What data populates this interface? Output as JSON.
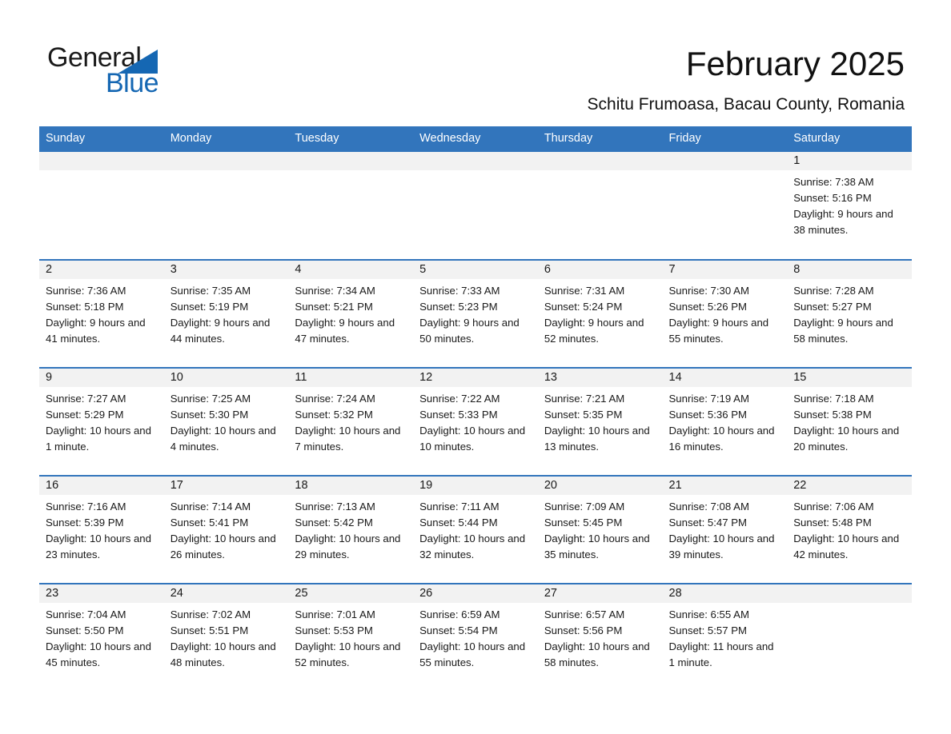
{
  "brand": {
    "name_part1": "General",
    "name_part2": "Blue",
    "logo_icon": "general-blue-triangle-logo",
    "blue": "#1567b3"
  },
  "header": {
    "title": "February 2025",
    "subtitle": "Schitu Frumoasa, Bacau County, Romania",
    "accent_color": "#3275bc",
    "band_color": "#f2f2f2"
  },
  "weekday_headers": [
    "Sunday",
    "Monday",
    "Tuesday",
    "Wednesday",
    "Thursday",
    "Friday",
    "Saturday"
  ],
  "weeks": [
    [
      {
        "day": "",
        "sunrise": "",
        "sunset": "",
        "daylight": ""
      },
      {
        "day": "",
        "sunrise": "",
        "sunset": "",
        "daylight": ""
      },
      {
        "day": "",
        "sunrise": "",
        "sunset": "",
        "daylight": ""
      },
      {
        "day": "",
        "sunrise": "",
        "sunset": "",
        "daylight": ""
      },
      {
        "day": "",
        "sunrise": "",
        "sunset": "",
        "daylight": ""
      },
      {
        "day": "",
        "sunrise": "",
        "sunset": "",
        "daylight": ""
      },
      {
        "day": "1",
        "sunrise": "Sunrise: 7:38 AM",
        "sunset": "Sunset: 5:16 PM",
        "daylight": "Daylight: 9 hours and 38 minutes."
      }
    ],
    [
      {
        "day": "2",
        "sunrise": "Sunrise: 7:36 AM",
        "sunset": "Sunset: 5:18 PM",
        "daylight": "Daylight: 9 hours and 41 minutes."
      },
      {
        "day": "3",
        "sunrise": "Sunrise: 7:35 AM",
        "sunset": "Sunset: 5:19 PM",
        "daylight": "Daylight: 9 hours and 44 minutes."
      },
      {
        "day": "4",
        "sunrise": "Sunrise: 7:34 AM",
        "sunset": "Sunset: 5:21 PM",
        "daylight": "Daylight: 9 hours and 47 minutes."
      },
      {
        "day": "5",
        "sunrise": "Sunrise: 7:33 AM",
        "sunset": "Sunset: 5:23 PM",
        "daylight": "Daylight: 9 hours and 50 minutes."
      },
      {
        "day": "6",
        "sunrise": "Sunrise: 7:31 AM",
        "sunset": "Sunset: 5:24 PM",
        "daylight": "Daylight: 9 hours and 52 minutes."
      },
      {
        "day": "7",
        "sunrise": "Sunrise: 7:30 AM",
        "sunset": "Sunset: 5:26 PM",
        "daylight": "Daylight: 9 hours and 55 minutes."
      },
      {
        "day": "8",
        "sunrise": "Sunrise: 7:28 AM",
        "sunset": "Sunset: 5:27 PM",
        "daylight": "Daylight: 9 hours and 58 minutes."
      }
    ],
    [
      {
        "day": "9",
        "sunrise": "Sunrise: 7:27 AM",
        "sunset": "Sunset: 5:29 PM",
        "daylight": "Daylight: 10 hours and 1 minute."
      },
      {
        "day": "10",
        "sunrise": "Sunrise: 7:25 AM",
        "sunset": "Sunset: 5:30 PM",
        "daylight": "Daylight: 10 hours and 4 minutes."
      },
      {
        "day": "11",
        "sunrise": "Sunrise: 7:24 AM",
        "sunset": "Sunset: 5:32 PM",
        "daylight": "Daylight: 10 hours and 7 minutes."
      },
      {
        "day": "12",
        "sunrise": "Sunrise: 7:22 AM",
        "sunset": "Sunset: 5:33 PM",
        "daylight": "Daylight: 10 hours and 10 minutes."
      },
      {
        "day": "13",
        "sunrise": "Sunrise: 7:21 AM",
        "sunset": "Sunset: 5:35 PM",
        "daylight": "Daylight: 10 hours and 13 minutes."
      },
      {
        "day": "14",
        "sunrise": "Sunrise: 7:19 AM",
        "sunset": "Sunset: 5:36 PM",
        "daylight": "Daylight: 10 hours and 16 minutes."
      },
      {
        "day": "15",
        "sunrise": "Sunrise: 7:18 AM",
        "sunset": "Sunset: 5:38 PM",
        "daylight": "Daylight: 10 hours and 20 minutes."
      }
    ],
    [
      {
        "day": "16",
        "sunrise": "Sunrise: 7:16 AM",
        "sunset": "Sunset: 5:39 PM",
        "daylight": "Daylight: 10 hours and 23 minutes."
      },
      {
        "day": "17",
        "sunrise": "Sunrise: 7:14 AM",
        "sunset": "Sunset: 5:41 PM",
        "daylight": "Daylight: 10 hours and 26 minutes."
      },
      {
        "day": "18",
        "sunrise": "Sunrise: 7:13 AM",
        "sunset": "Sunset: 5:42 PM",
        "daylight": "Daylight: 10 hours and 29 minutes."
      },
      {
        "day": "19",
        "sunrise": "Sunrise: 7:11 AM",
        "sunset": "Sunset: 5:44 PM",
        "daylight": "Daylight: 10 hours and 32 minutes."
      },
      {
        "day": "20",
        "sunrise": "Sunrise: 7:09 AM",
        "sunset": "Sunset: 5:45 PM",
        "daylight": "Daylight: 10 hours and 35 minutes."
      },
      {
        "day": "21",
        "sunrise": "Sunrise: 7:08 AM",
        "sunset": "Sunset: 5:47 PM",
        "daylight": "Daylight: 10 hours and 39 minutes."
      },
      {
        "day": "22",
        "sunrise": "Sunrise: 7:06 AM",
        "sunset": "Sunset: 5:48 PM",
        "daylight": "Daylight: 10 hours and 42 minutes."
      }
    ],
    [
      {
        "day": "23",
        "sunrise": "Sunrise: 7:04 AM",
        "sunset": "Sunset: 5:50 PM",
        "daylight": "Daylight: 10 hours and 45 minutes."
      },
      {
        "day": "24",
        "sunrise": "Sunrise: 7:02 AM",
        "sunset": "Sunset: 5:51 PM",
        "daylight": "Daylight: 10 hours and 48 minutes."
      },
      {
        "day": "25",
        "sunrise": "Sunrise: 7:01 AM",
        "sunset": "Sunset: 5:53 PM",
        "daylight": "Daylight: 10 hours and 52 minutes."
      },
      {
        "day": "26",
        "sunrise": "Sunrise: 6:59 AM",
        "sunset": "Sunset: 5:54 PM",
        "daylight": "Daylight: 10 hours and 55 minutes."
      },
      {
        "day": "27",
        "sunrise": "Sunrise: 6:57 AM",
        "sunset": "Sunset: 5:56 PM",
        "daylight": "Daylight: 10 hours and 58 minutes."
      },
      {
        "day": "28",
        "sunrise": "Sunrise: 6:55 AM",
        "sunset": "Sunset: 5:57 PM",
        "daylight": "Daylight: 11 hours and 1 minute."
      },
      {
        "day": "",
        "sunrise": "",
        "sunset": "",
        "daylight": ""
      }
    ]
  ]
}
